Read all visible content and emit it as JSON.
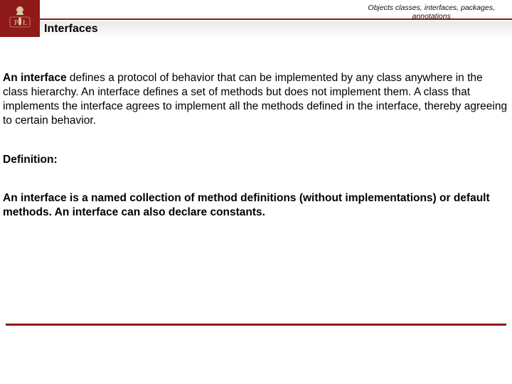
{
  "header": {
    "breadcrumb_line1": "Objects classes, interfaces, packages,",
    "breadcrumb_line2": "annotations",
    "slide_title": "Interfaces",
    "logo_letters": {
      "left": "P",
      "right": "Ł"
    }
  },
  "body": {
    "para1_lead": "An interface",
    "para1_rest": " defines a protocol of behavior that can be implemented by any class anywhere in the class hierarchy. An interface defines a set of methods but does not implement them. A class that implements the interface agrees to implement all the methods defined in the interface, thereby agreeing to certain behavior.",
    "definition_label": "Definition:",
    "definition_body": "An interface is a named collection of method definitions (without implementations) or default methods. An interface can also declare constants."
  },
  "colors": {
    "brand": "#8f1a1a"
  }
}
